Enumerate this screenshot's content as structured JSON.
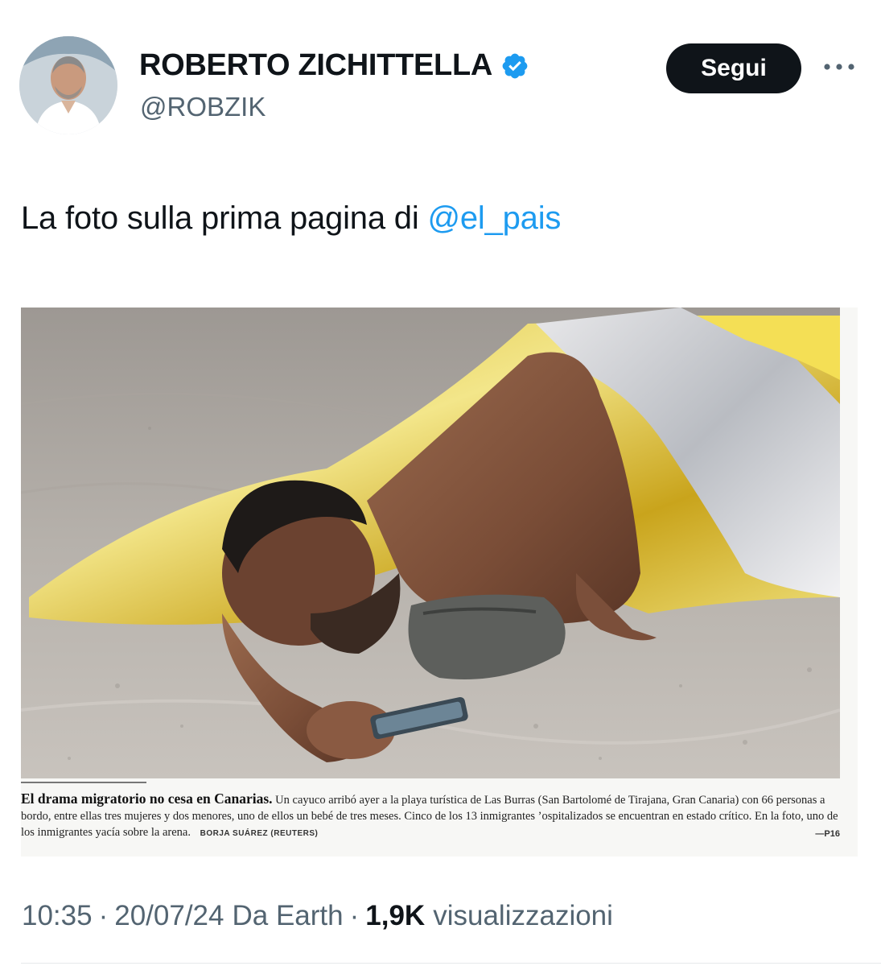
{
  "author": {
    "display_name": "ROBERTO ZICHITTELLA",
    "handle": "@ROBZIK",
    "verified": true
  },
  "actions": {
    "follow_label": "Segui",
    "more_icon": "more-horizontal-icon"
  },
  "tweet": {
    "text_prefix": "La foto sulla prima pagina di ",
    "mention": "@el_pais"
  },
  "media": {
    "caption_headline": "El drama migratorio no cesa en Canarias.",
    "caption_body": "Un cayuco arribó ayer a la playa turística de Las Burras (San Bartolomé de Tirajana, Gran Canaria) con 66 personas a bordo, entre ellas tres mujeres y dos menores, uno de ellos un bebé de tres meses. Cinco de los 13 inmigrantes ’ospitalizados se encuentran en estado crítico. En la foto, uno de los inmigrantes yacía sobre la arena.",
    "caption_credit": "BORJA SUÁREZ (REUTERS)",
    "caption_page": "—P16"
  },
  "meta": {
    "time": "10:35",
    "dot1": "·",
    "date": "20/07/24",
    "source": "Da Earth",
    "dot2": "·",
    "views_count": "1,9K",
    "views_label": "visualizzazioni"
  },
  "colors": {
    "accent": "#1d9bf0",
    "text": "#0f1419",
    "secondary": "#536471",
    "button_bg": "#0f1419"
  }
}
